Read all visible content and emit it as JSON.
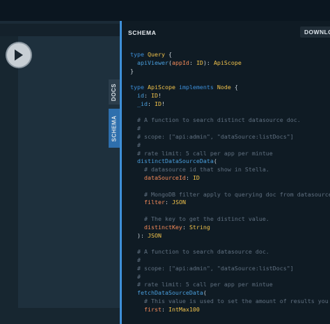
{
  "schema_panel": {
    "title": "SCHEMA",
    "download_label": "DOWNLO"
  },
  "tabs": {
    "docs": "DOCS",
    "schema": "SCHEMA"
  },
  "code_lines": [
    [
      [
        "kw",
        "type "
      ],
      [
        "ty",
        "Query"
      ],
      [
        "pn",
        " {"
      ]
    ],
    [
      [
        "fd",
        "  apiViewer"
      ],
      [
        "pn",
        "("
      ],
      [
        "ar",
        "appId"
      ],
      [
        "pn",
        ": "
      ],
      [
        "ty",
        "ID"
      ],
      [
        "pn",
        "): "
      ],
      [
        "ty",
        "ApiScope"
      ]
    ],
    [
      [
        "pn",
        "}"
      ]
    ],
    [],
    [
      [
        "kw",
        "type "
      ],
      [
        "ty",
        "ApiScope "
      ],
      [
        "kw",
        "implements "
      ],
      [
        "ty",
        "Node"
      ],
      [
        "pn",
        " {"
      ]
    ],
    [
      [
        "fd",
        "  id"
      ],
      [
        "pn",
        ": "
      ],
      [
        "ty",
        "ID"
      ],
      [
        "pn",
        "!"
      ]
    ],
    [
      [
        "fd",
        "  _id"
      ],
      [
        "pn",
        ": "
      ],
      [
        "ty",
        "ID"
      ],
      [
        "pn",
        "!"
      ]
    ],
    [],
    [
      [
        "cm",
        "  # A function to search distinct datasource doc."
      ]
    ],
    [
      [
        "cm",
        "  #"
      ]
    ],
    [
      [
        "cm",
        "  # scope: [\"api:admin\", \"dataSource:listDocs\"]"
      ]
    ],
    [
      [
        "cm",
        "  #"
      ]
    ],
    [
      [
        "cm",
        "  # rate limit: 5 call per app per mintue"
      ]
    ],
    [
      [
        "fd",
        "  distinctDataSourceData"
      ],
      [
        "pn",
        "("
      ]
    ],
    [
      [
        "cm",
        "    # datasource id that show in Stella."
      ]
    ],
    [
      [
        "ar",
        "    dataSourceId"
      ],
      [
        "pn",
        ": "
      ],
      [
        "ty",
        "ID"
      ]
    ],
    [],
    [
      [
        "cm",
        "    # MongoDB filter apply to querying doc from datasource."
      ]
    ],
    [
      [
        "ar",
        "    filter"
      ],
      [
        "pn",
        ": "
      ],
      [
        "ty",
        "JSON"
      ]
    ],
    [],
    [
      [
        "cm",
        "    # The key to get the distinct value."
      ]
    ],
    [
      [
        "ar",
        "    distinctKey"
      ],
      [
        "pn",
        ": "
      ],
      [
        "ty",
        "String"
      ]
    ],
    [
      [
        "pn",
        "  ): "
      ],
      [
        "ty",
        "JSON"
      ]
    ],
    [],
    [
      [
        "cm",
        "  # A function to search datasource doc."
      ]
    ],
    [
      [
        "cm",
        "  #"
      ]
    ],
    [
      [
        "cm",
        "  # scope: [\"api:admin\", \"dataSource:listDocs\"]"
      ]
    ],
    [
      [
        "cm",
        "  #"
      ]
    ],
    [
      [
        "cm",
        "  # rate limit: 5 call per app per mintue"
      ]
    ],
    [
      [
        "fd",
        "  fetchDataSourceData"
      ],
      [
        "pn",
        "("
      ]
    ],
    [
      [
        "cm",
        "    # This value is used to set the amount of results you get"
      ]
    ],
    [
      [
        "ar",
        "    first"
      ],
      [
        "pn",
        ": "
      ],
      [
        "ty",
        "IntMax100"
      ]
    ]
  ]
}
